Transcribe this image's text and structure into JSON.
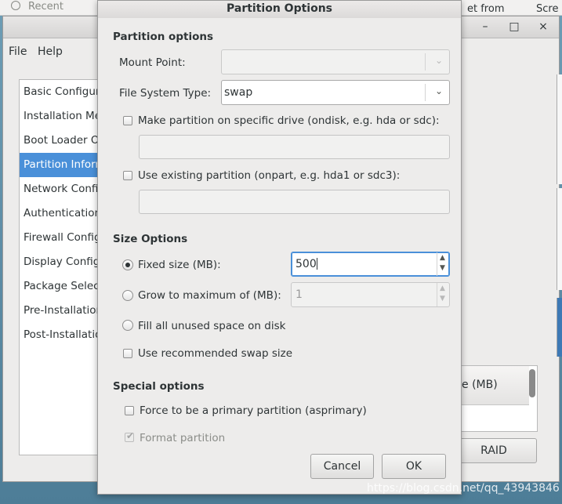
{
  "background": {
    "recent_label": "Recent",
    "top_right_1": "et from",
    "top_right_2": "Scre",
    "main_window": {
      "controls": [
        "–",
        "□",
        "×"
      ],
      "menu": [
        "File",
        "Help"
      ],
      "nav_items": [
        "Basic Configuration",
        "Installation Method",
        "Boot Loader Options",
        "Partition Information",
        "Network Configuration",
        "Authentication",
        "Firewall Configuration",
        "Display Configuration",
        "Package Selection",
        "Pre-Installation Script",
        "Post-Installation Script"
      ],
      "selected_nav_index": 3,
      "table_header_partial": "e (MB)",
      "raid_button": "RAID"
    }
  },
  "dialog": {
    "title": "Partition Options",
    "partition_options": {
      "header": "Partition options",
      "mount_point_label": "Mount Point:",
      "mount_point_value": "",
      "fs_type_label": "File System Type:",
      "fs_type_value": "swap",
      "specific_drive_label": "Make partition on specific drive (ondisk, e.g. hda or sdc):",
      "specific_drive_checked": false,
      "specific_drive_value": "",
      "existing_partition_label": "Use existing partition (onpart, e.g. hda1 or sdc3):",
      "existing_partition_checked": false,
      "existing_partition_value": ""
    },
    "size_options": {
      "header": "Size Options",
      "fixed_size_label": "Fixed size (MB):",
      "fixed_size_value": "500",
      "grow_label": "Grow to maximum of (MB):",
      "grow_value": "1",
      "fill_label": "Fill all unused space on disk",
      "recommended_swap_label": "Use recommended swap size",
      "selected_option": "fixed"
    },
    "special_options": {
      "header": "Special options",
      "primary_label": "Force to be a primary partition (asprimary)",
      "primary_checked": false,
      "format_label": "Format partition",
      "format_checked": true
    },
    "buttons": {
      "cancel": "Cancel",
      "ok": "OK"
    }
  },
  "watermark": "https://blog.csdn.net/qq_43943846"
}
